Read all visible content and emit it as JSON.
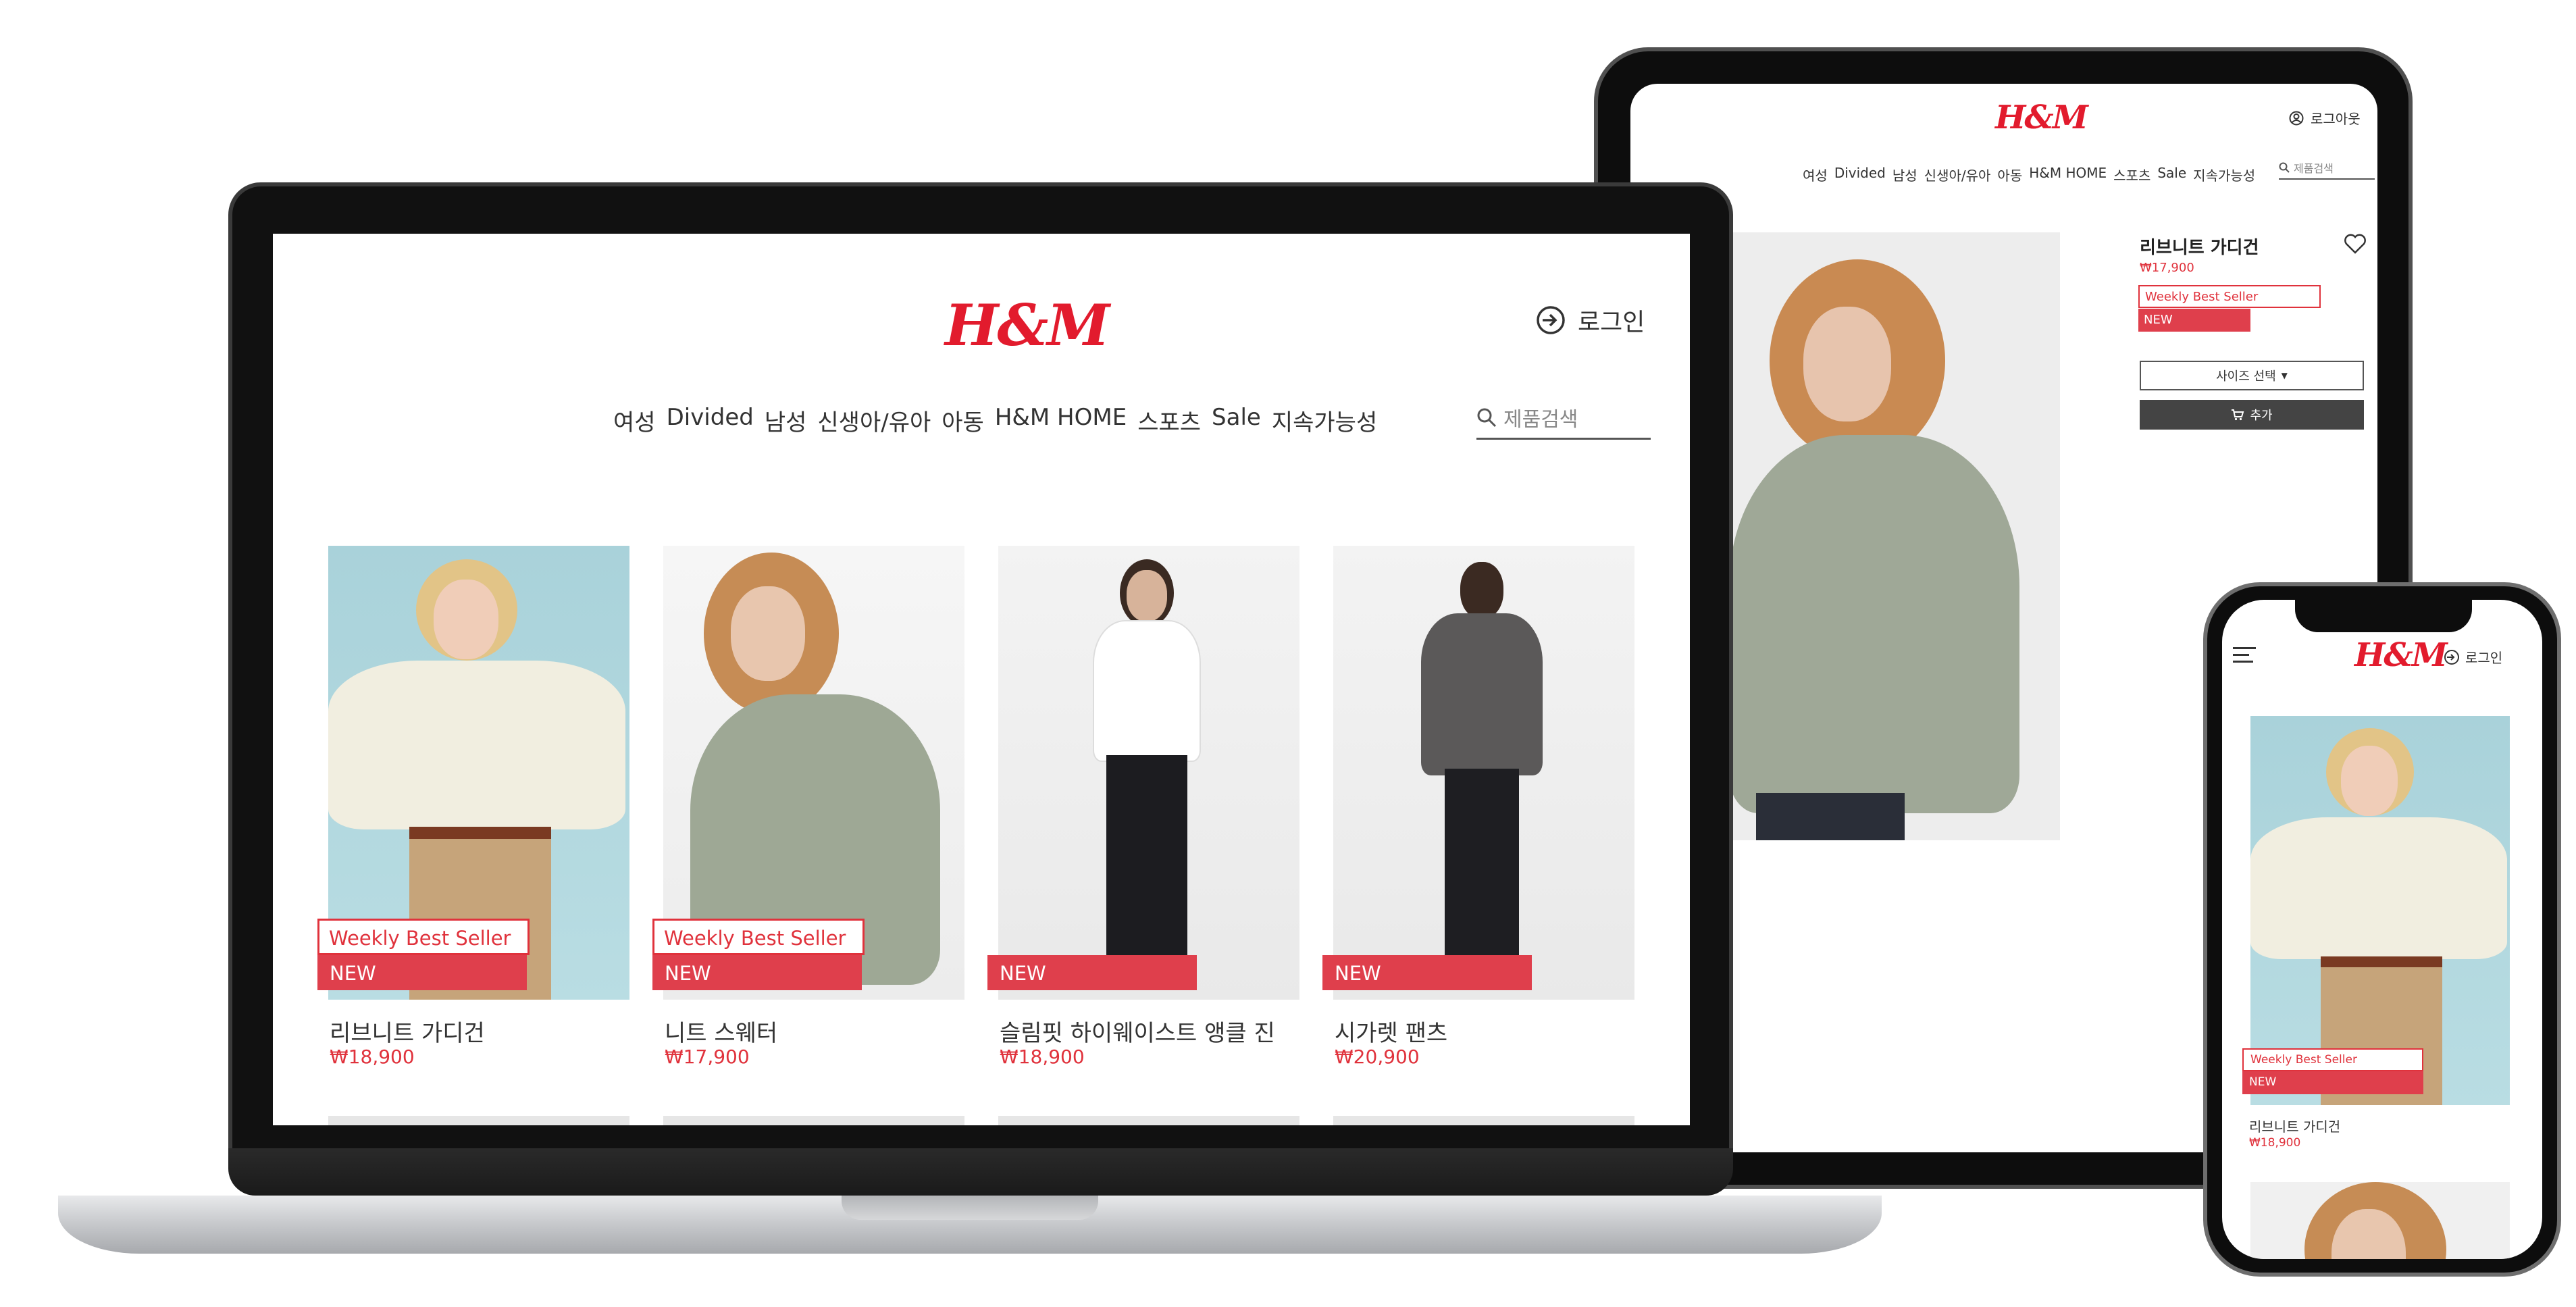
{
  "brand": "H&M",
  "laptop": {
    "login_label": "로그인",
    "nav": [
      "여성",
      "Divided",
      "남성",
      "신생아/유아",
      "아동",
      "H&M HOME",
      "스포츠",
      "Sale",
      "지속가능성"
    ],
    "search_placeholder": "제품검색",
    "products": [
      {
        "name": "리브니트 가디건",
        "price": "₩18,900",
        "weekly": "Weekly Best Seller",
        "new": "NEW"
      },
      {
        "name": "니트 스웨터",
        "price": "₩17,900",
        "weekly": "Weekly Best Seller",
        "new": "NEW"
      },
      {
        "name": "슬림핏 하이웨이스트 앵클 진",
        "price": "₩18,900",
        "weekly": "",
        "new": "NEW"
      },
      {
        "name": "시가렛 팬츠",
        "price": "₩20,900",
        "weekly": "",
        "new": "NEW"
      }
    ]
  },
  "tablet": {
    "logout_label": "로그아웃",
    "nav": [
      "여성",
      "Divided",
      "남성",
      "신생아/유아",
      "아동",
      "H&M HOME",
      "스포츠",
      "Sale",
      "지속가능성"
    ],
    "search_placeholder": "제품검색",
    "product": {
      "name": "리브니트 가디건",
      "price": "₩17,900",
      "weekly": "Weekly Best Seller",
      "new": "NEW"
    },
    "size_select": "사이즈 선택",
    "add_label": "추가"
  },
  "phone": {
    "login_label": "로그인",
    "product": {
      "name": "리브니트 가디건",
      "price": "₩18,900",
      "weekly": "Weekly Best Seller",
      "new": "NEW"
    }
  },
  "colors": {
    "brand_red": "#e21b2d",
    "tag_red": "#df3f4c",
    "price_red": "#e0323c"
  }
}
